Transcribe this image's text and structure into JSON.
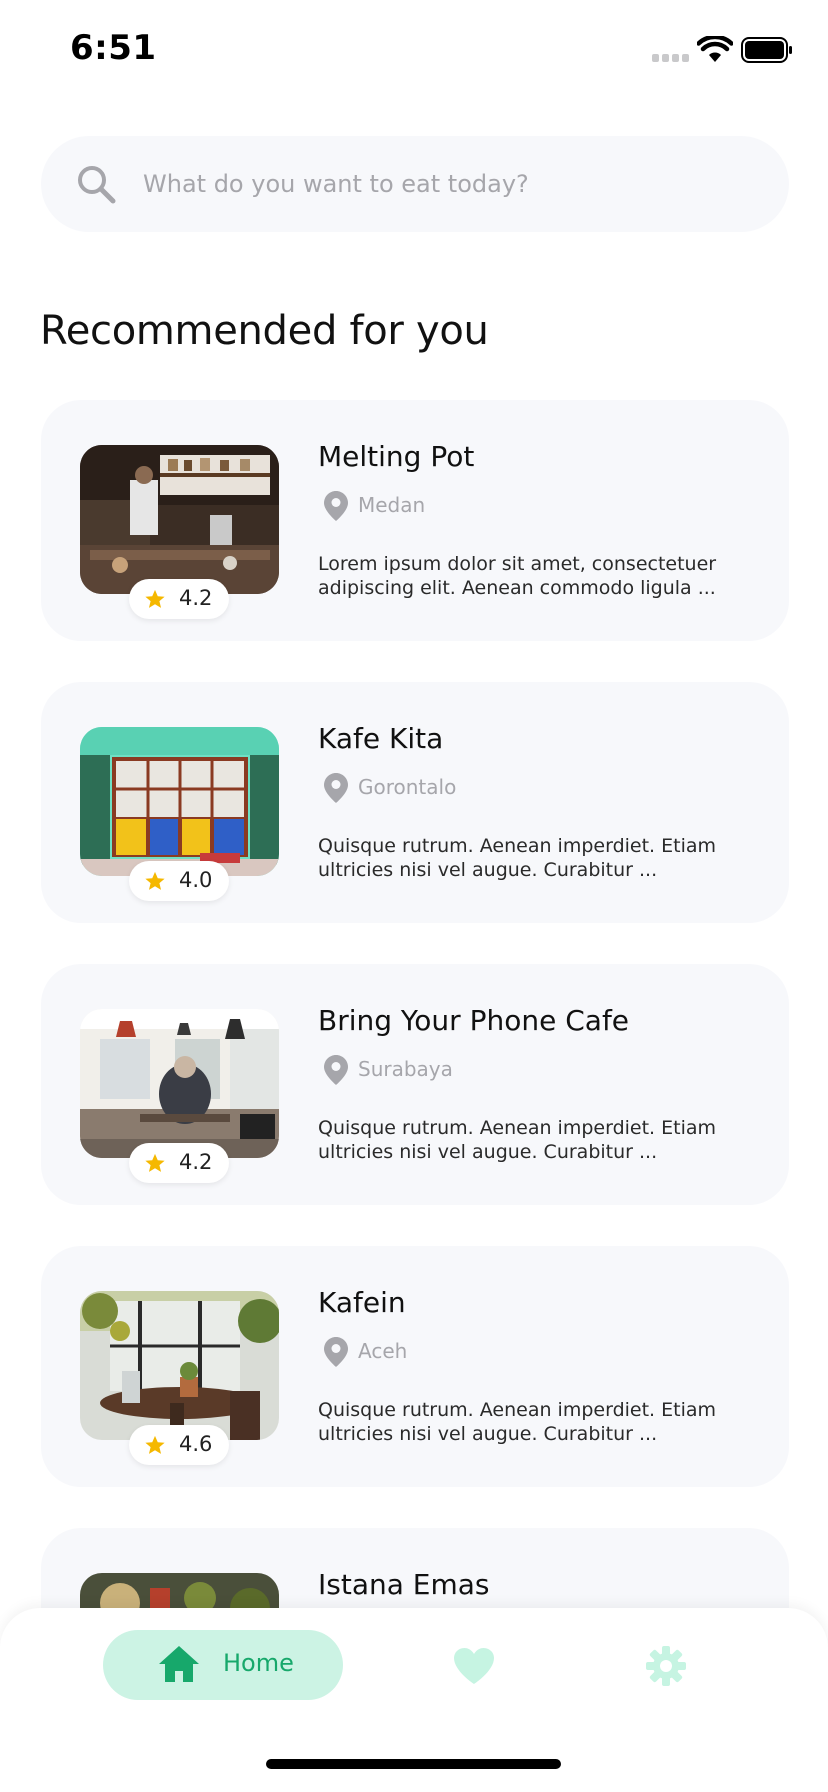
{
  "status_bar": {
    "time": "6:51"
  },
  "search": {
    "placeholder": "What do you want to eat today?",
    "value": ""
  },
  "section": {
    "title": "Recommended for you"
  },
  "restaurants": [
    {
      "name": "Melting Pot",
      "location": "Medan",
      "rating": "4.2",
      "description": "Lorem ipsum dolor sit amet, consectetuer adipiscing elit. Aenean commodo ligula ..."
    },
    {
      "name": "Kafe Kita",
      "location": "Gorontalo",
      "rating": "4.0",
      "description": "Quisque rutrum. Aenean imperdiet. Etiam ultricies nisi vel augue. Curabitur ..."
    },
    {
      "name": "Bring Your Phone Cafe",
      "location": "Surabaya",
      "rating": "4.2",
      "description": "Quisque rutrum. Aenean imperdiet. Etiam ultricies nisi vel augue. Curabitur ..."
    },
    {
      "name": "Kafein",
      "location": "Aceh",
      "rating": "4.6",
      "description": "Quisque rutrum. Aenean imperdiet. Etiam ultricies nisi vel augue. Curabitur ..."
    },
    {
      "name": "Istana Emas",
      "location": "",
      "rating": "",
      "description": ""
    }
  ],
  "nav": {
    "home_label": "Home",
    "home_icon": "home-icon",
    "favorites_icon": "heart-icon",
    "settings_icon": "gear-icon",
    "active_color": "#17a86b",
    "active_bg": "#ccf3e4",
    "inactive_color": "#c6f4e2"
  },
  "colors": {
    "star": "#f5b800",
    "card_bg": "#f7f8fb",
    "muted_text": "#a6a6ab"
  }
}
